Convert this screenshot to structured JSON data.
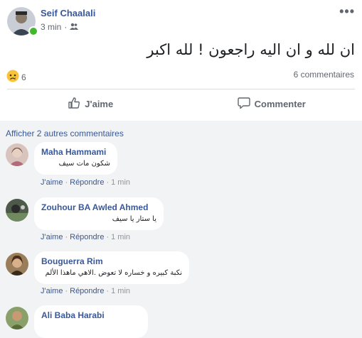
{
  "post": {
    "author": "Seif Chaalali",
    "time": "3 min",
    "separator": "·",
    "more_icon": "•••",
    "text": "ان لله و ان اليه راجعون ! لله اكبر",
    "reaction_count": "6",
    "comments_count": "6 commentaires",
    "actions": {
      "like": "J'aime",
      "comment": "Commenter"
    }
  },
  "comments_section": {
    "more_link": "Afficher 2 autres commentaires",
    "comments": [
      {
        "name": "Maha Hammami",
        "text": "شكون مات سيف",
        "like": "J'aime",
        "reply": "Répondre",
        "time": "1 min"
      },
      {
        "name": "Zouhour BA Awled Ahmed",
        "text": "يا ستار يا سيف",
        "like": "J'aime",
        "reply": "Répondre",
        "time": "1 min"
      },
      {
        "name": "Bouguerra Rim",
        "text": "نكبة كبيره و خساره لا تعوض .الاهي ماهذا الألم",
        "like": "J'aime",
        "reply": "Répondre",
        "time": "1 min"
      },
      {
        "name": "Ali Baba Harabi",
        "text": "",
        "like": "",
        "reply": "",
        "time": ""
      }
    ]
  },
  "colors": {
    "link": "#385898",
    "online": "#42b72a",
    "background": "#f2f3f5"
  }
}
